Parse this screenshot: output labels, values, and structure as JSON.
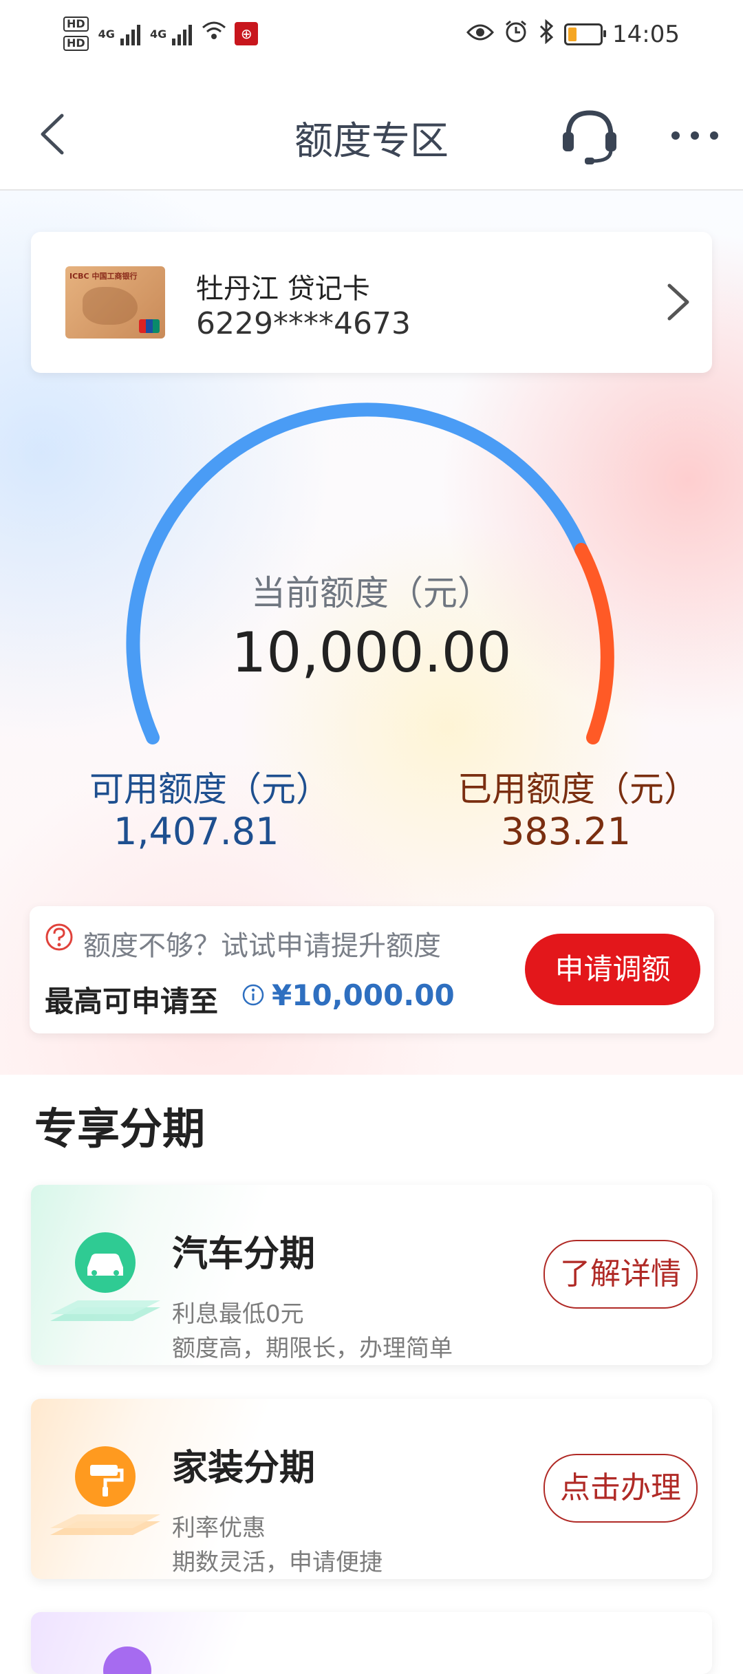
{
  "status_bar": {
    "hd1": "HD",
    "hd2": "HD",
    "net1": "4G",
    "net2": "4G",
    "time": "14:05",
    "icons": [
      "eye-icon",
      "alarm-icon",
      "bluetooth-icon",
      "battery-icon"
    ]
  },
  "header": {
    "title": "额度专区",
    "icons": [
      "back-icon",
      "headset-icon",
      "more-icon"
    ]
  },
  "card": {
    "name": "牡丹江 贷记卡",
    "number": "6229****4673",
    "brand_text": "ICBC 中国工商银行"
  },
  "limit": {
    "current_label": "当前额度（元）",
    "current_value": "10,000.00",
    "available_label": "可用额度（元）",
    "available_value": "1,407.81",
    "used_label": "已用额度（元）",
    "used_value": "383.21",
    "colors": {
      "available_arc": "#4a9cf5",
      "used_arc": "#ff5a26"
    }
  },
  "promo": {
    "text": "额度不够？试试申请提升额度",
    "max_label": "最高可申请至",
    "max_amount": "¥10,000.00",
    "button": "申请调额",
    "button_color": "#e3171b"
  },
  "installments": {
    "section_title": "专享分期",
    "items": [
      {
        "icon": "car-icon",
        "title": "汽车分期",
        "line1": "利息最低0元",
        "line2": "额度高，期限长，办理简单",
        "button": "了解详情"
      },
      {
        "icon": "paint-roller-icon",
        "title": "家装分期",
        "line1": "利率优惠",
        "line2": "期数灵活，申请便捷",
        "button": "点击办理"
      }
    ]
  }
}
